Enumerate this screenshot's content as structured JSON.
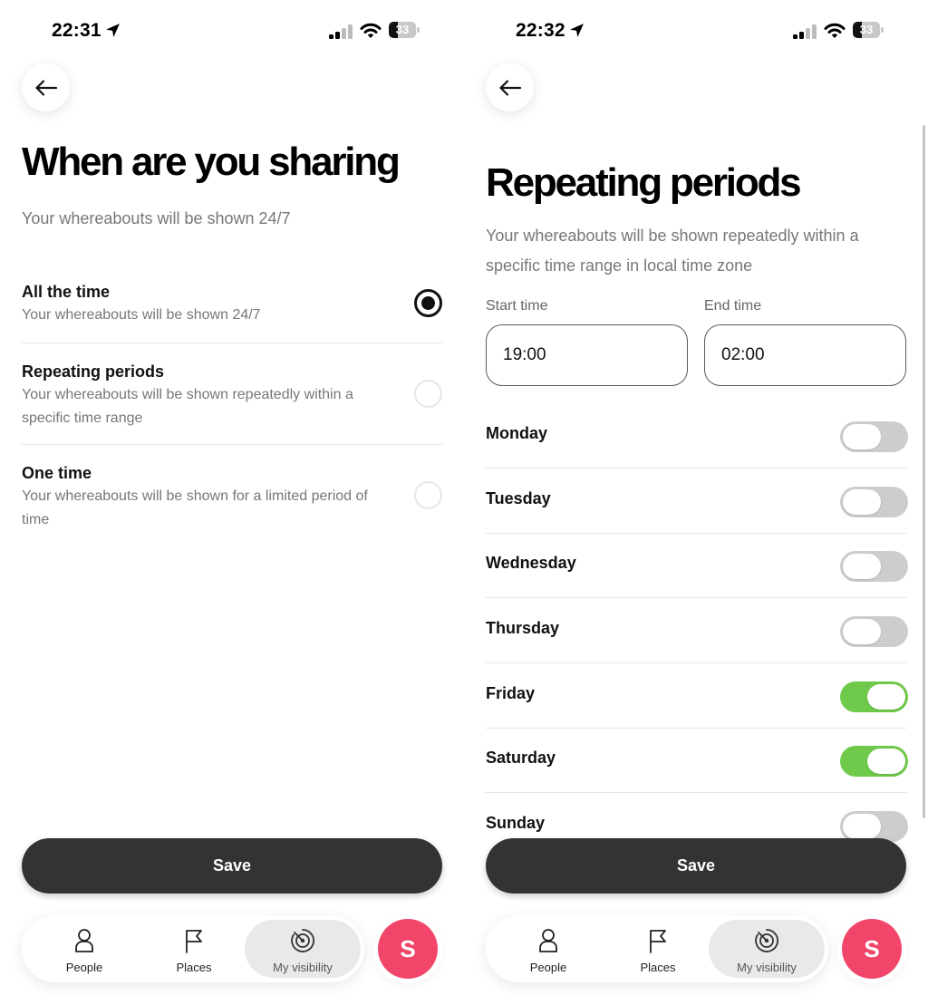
{
  "colors": {
    "toggle_on": "#6fc94a",
    "toggle_off": "#cdcdcd",
    "save_button": "#333333",
    "avatar": "#f2456a",
    "nav_active": "#e9e9e9"
  },
  "left_screen": {
    "status_bar": {
      "time": "22:31",
      "location_icon": "location-arrow-icon",
      "signal_icon": "cellular-signal-icon",
      "wifi_icon": "wifi-icon",
      "battery": "33",
      "battery_level_percent": 33
    },
    "back_icon": "arrow-left-icon",
    "title": "When are you sharing",
    "subtitle": "Your whereabouts will be shown 24/7",
    "options": [
      {
        "title": "All the time",
        "description": "Your whereabouts will be shown 24/7",
        "selected": true
      },
      {
        "title": "Repeating periods",
        "description": "Your whereabouts will be shown repeatedly within a specific time range",
        "selected": false
      },
      {
        "title": "One time",
        "description": "Your whereabouts will be shown for a limited period of time",
        "selected": false
      }
    ],
    "save_label": "Save"
  },
  "right_screen": {
    "status_bar": {
      "time": "22:32",
      "location_icon": "location-arrow-icon",
      "signal_icon": "cellular-signal-icon",
      "wifi_icon": "wifi-icon",
      "battery": "33",
      "battery_level_percent": 33
    },
    "back_icon": "arrow-left-icon",
    "title": "Repeating periods",
    "subtitle": "Your whereabouts will be shown repeatedly within a specific time range in local time zone",
    "start_time": {
      "label": "Start time",
      "value": "19:00"
    },
    "end_time": {
      "label": "End time",
      "value": "02:00"
    },
    "days": [
      {
        "label": "Monday",
        "enabled": false
      },
      {
        "label": "Tuesday",
        "enabled": false
      },
      {
        "label": "Wednesday",
        "enabled": false
      },
      {
        "label": "Thursday",
        "enabled": false
      },
      {
        "label": "Friday",
        "enabled": true
      },
      {
        "label": "Saturday",
        "enabled": true
      },
      {
        "label": "Sunday",
        "enabled": false
      }
    ],
    "save_label": "Save"
  },
  "nav": {
    "items": [
      {
        "label": "People",
        "icon": "person-icon",
        "active": false
      },
      {
        "label": "Places",
        "icon": "flag-icon",
        "active": false
      },
      {
        "label": "My visibility",
        "icon": "visibility-radar-icon",
        "active": true
      }
    ],
    "avatar_letter": "S"
  }
}
